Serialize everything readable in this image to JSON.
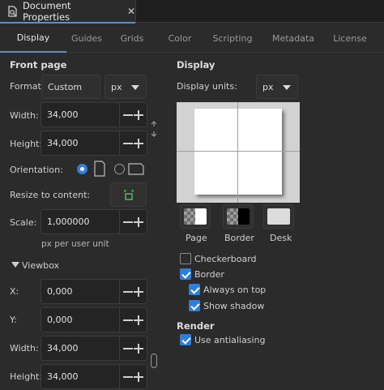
{
  "window": {
    "tab_title": "Document Properties",
    "close_glyph": "✕"
  },
  "tabs": [
    {
      "label": "Display",
      "active": true
    },
    {
      "label": "Guides",
      "active": false
    },
    {
      "label": "Grids",
      "active": false
    },
    {
      "label": "Color",
      "active": false
    },
    {
      "label": "Scripting",
      "active": false
    },
    {
      "label": "Metadata",
      "active": false
    },
    {
      "label": "License",
      "active": false
    }
  ],
  "front_page": {
    "title": "Front page",
    "format_label": "Format:",
    "format_value": "Custom",
    "unit_value": "px",
    "width_label": "Width:",
    "width_value": "34,000",
    "height_label": "Height:",
    "height_value": "34,000",
    "orientation_label": "Orientation:",
    "orientation": "portrait",
    "resize_label": "Resize to content:",
    "scale_label": "Scale:",
    "scale_value": "1,000000",
    "scale_hint": "px per user unit"
  },
  "viewbox": {
    "title": "Viewbox",
    "x_label": "X:",
    "x_value": "0,000",
    "y_label": "Y:",
    "y_value": "0,000",
    "width_label": "Width:",
    "width_value": "34,000",
    "height_label": "Height:",
    "height_value": "34,000"
  },
  "display": {
    "title": "Display",
    "units_label": "Display units:",
    "units_value": "px",
    "swatch_labels": {
      "page": "Page",
      "border": "Border",
      "desk": "Desk"
    },
    "checkerboard": {
      "label": "Checkerboard",
      "checked": false
    },
    "border": {
      "label": "Border",
      "checked": true
    },
    "always_on_top": {
      "label": "Always on top",
      "checked": true
    },
    "show_shadow": {
      "label": "Show shadow",
      "checked": true
    }
  },
  "render": {
    "title": "Render",
    "antialiasing": {
      "label": "Use antialiasing",
      "checked": true
    }
  },
  "colors": {
    "accent": "#2f7fd8",
    "tab_underline": "#5e8fc7",
    "background": "#2b2b2b",
    "desk": "#d2d2d2"
  }
}
